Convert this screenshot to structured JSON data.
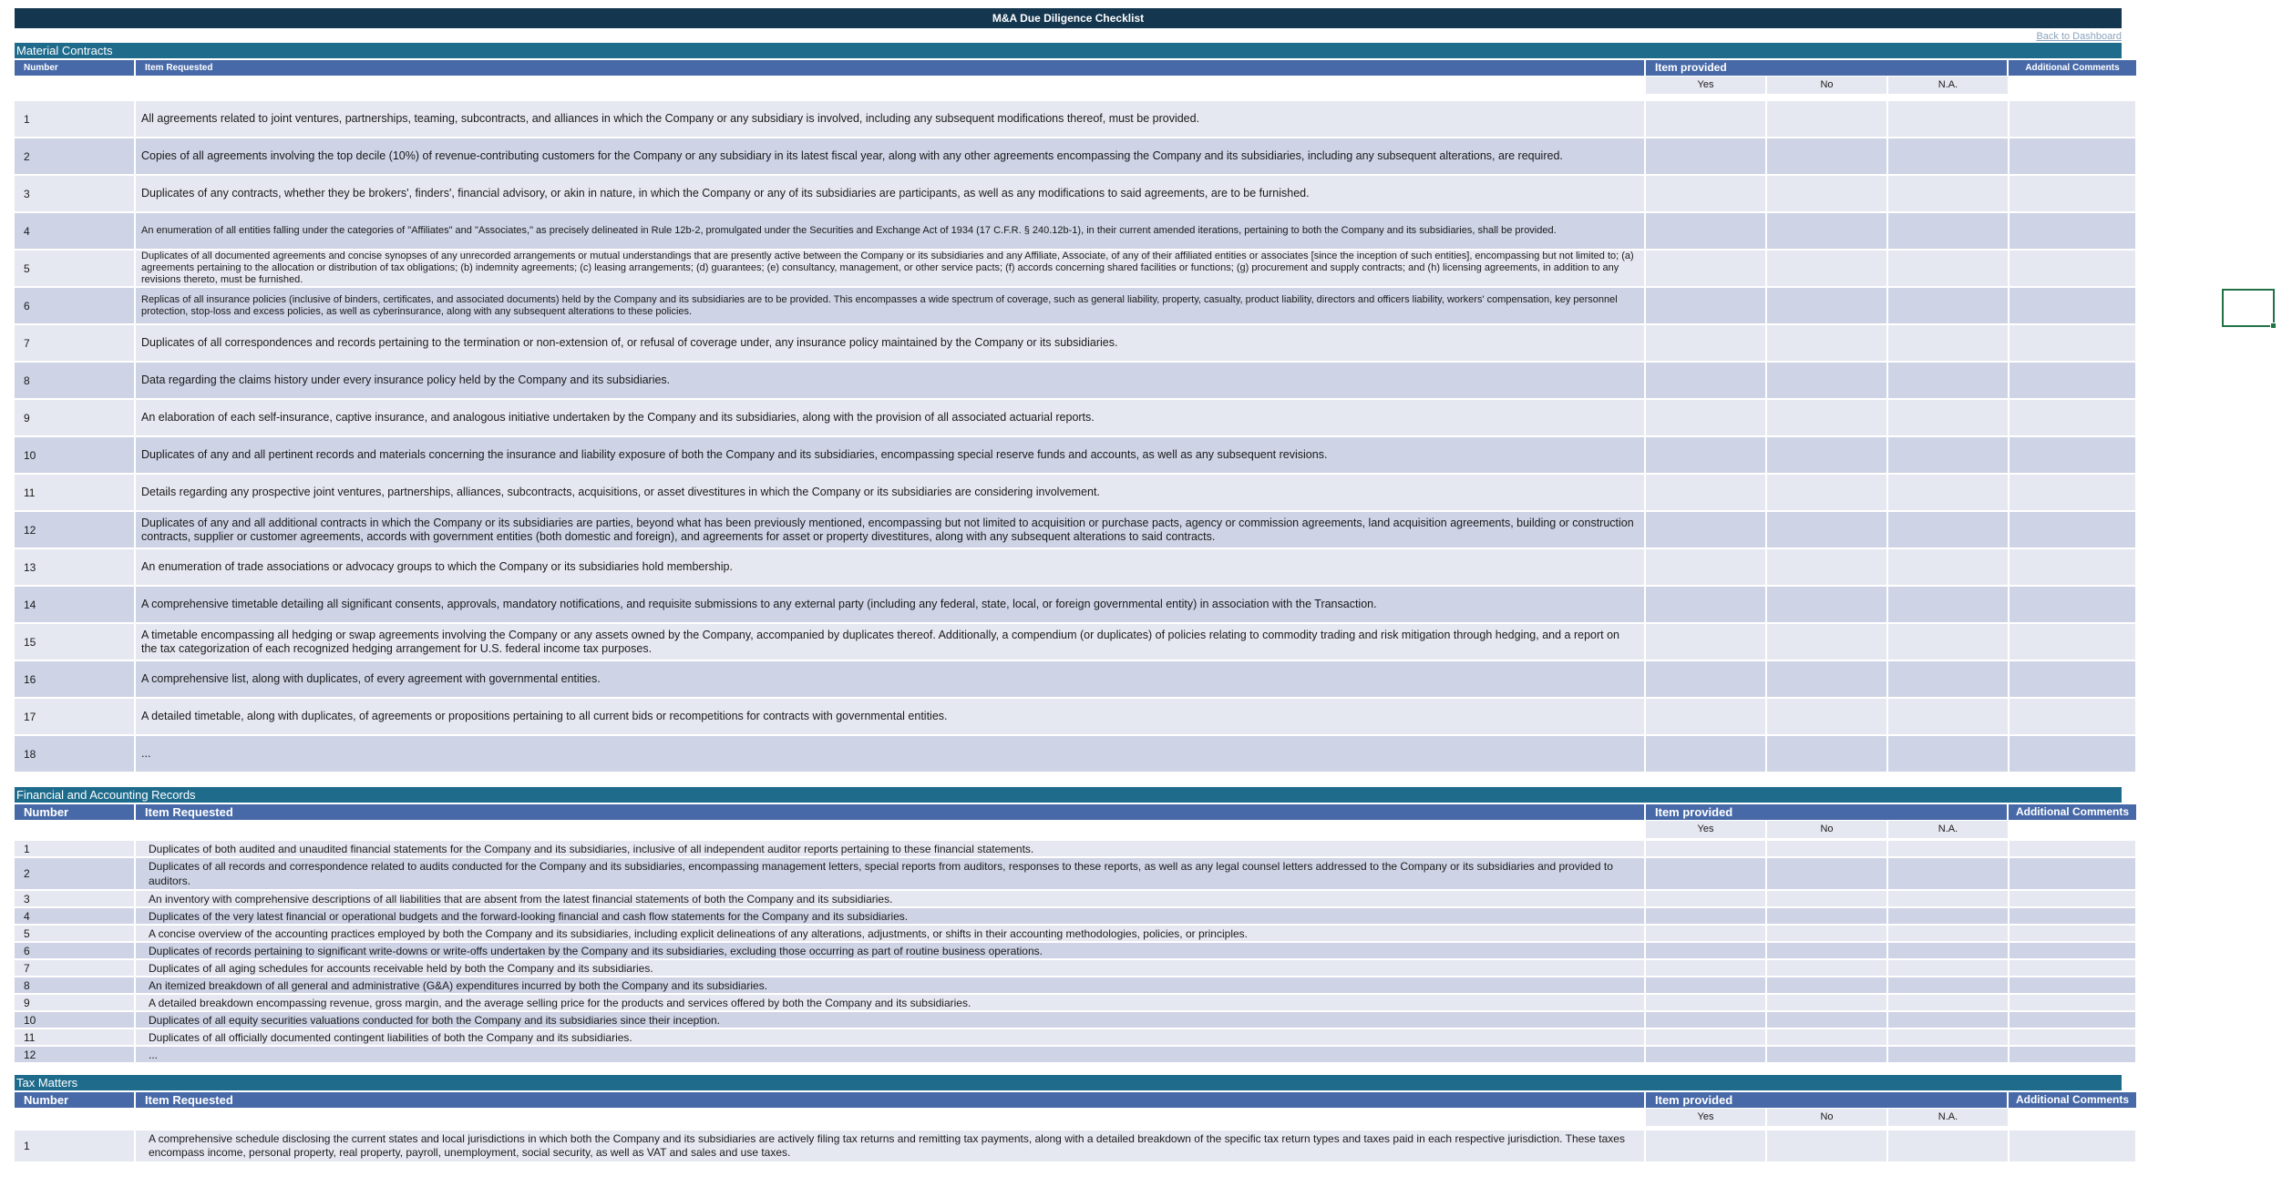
{
  "title": "M&A Due Diligence Checklist",
  "back_link": "Back to Dashboard",
  "headers": {
    "number": "Number",
    "item": "Item Requested",
    "item_alt": "Item Requested",
    "provided": "Item provided",
    "additional": "Additional Comments",
    "yes": "Yes",
    "no": "No",
    "na": "N.A."
  },
  "sections": [
    {
      "title": "Material Contracts",
      "rows": [
        {
          "n": "1",
          "t": "All agreements related to joint ventures, partnerships, teaming, subcontracts, and alliances in which the Company or any subsidiary is involved, including any subsequent modifications thereof, must be provided."
        },
        {
          "n": "2",
          "t": "Copies of all agreements involving the top decile (10%) of revenue-contributing customers for the Company or any subsidiary in its latest fiscal year, along with any other agreements encompassing the Company and its subsidiaries, including any subsequent alterations, are required."
        },
        {
          "n": "3",
          "t": "Duplicates of any contracts, whether they be brokers', finders', financial advisory, or akin in nature, in which the Company or any of its subsidiaries are participants, as well as any modifications to said agreements, are to be furnished."
        },
        {
          "n": "4",
          "t": "An enumeration of all entities falling under the categories of \"Affiliates\" and \"Associates,\" as precisely delineated in Rule 12b-2, promulgated under the Securities and Exchange Act of 1934 (17 C.F.R. § 240.12b-1), in their current amended iterations, pertaining to both the Company and its subsidiaries, shall be provided."
        },
        {
          "n": "5",
          "t": "Duplicates of all documented agreements and concise synopses of any unrecorded arrangements or mutual understandings that are presently active between the Company or its subsidiaries and any Affiliate, Associate, of any of their affiliated entities or associates [since the inception of such entities], encompassing but not limited to; (a) agreements pertaining to the allocation or distribution of tax obligations; (b) indemnity agreements; (c) leasing arrangements; (d) guarantees; (e) consultancy, management, or other service pacts; (f) accords concerning shared facilities or functions; (g) procurement and supply contracts; and (h) licensing agreements, in addition to any revisions thereto, must be furnished."
        },
        {
          "n": "6",
          "t": "Replicas of all insurance policies (inclusive of binders, certificates, and associated documents) held by the Company and its subsidiaries are to be provided. This encompasses a wide spectrum of coverage, such as general liability, property, casualty, product liability, directors and officers liability, workers' compensation, key personnel protection, stop-loss and excess policies, as well as cyberinsurance, along with any subsequent alterations to these policies."
        },
        {
          "n": "7",
          "t": "Duplicates of all correspondences and records pertaining to the termination or non-extension of, or refusal of coverage under, any insurance policy maintained by the Company or its subsidiaries."
        },
        {
          "n": "8",
          "t": "Data regarding the claims history under every insurance policy held by the Company and its subsidiaries."
        },
        {
          "n": "9",
          "t": "An elaboration of each self-insurance, captive insurance, and analogous initiative undertaken by the Company and its subsidiaries, along with the provision of all associated actuarial reports."
        },
        {
          "n": "10",
          "t": "Duplicates of any and all pertinent records and materials concerning the insurance and liability exposure of both the Company and its subsidiaries, encompassing special reserve funds and accounts, as well as any subsequent revisions."
        },
        {
          "n": "11",
          "t": "Details regarding any prospective joint ventures, partnerships, alliances, subcontracts, acquisitions, or asset divestitures in which the Company or its subsidiaries are considering involvement."
        },
        {
          "n": "12",
          "t": "Duplicates of any and all additional contracts in which the Company or its subsidiaries are parties, beyond what has been previously mentioned, encompassing but not limited to acquisition or purchase pacts, agency or commission agreements, land acquisition agreements, building or construction contracts, supplier or customer agreements, accords with government entities (both domestic and foreign), and agreements for asset or property divestitures, along with any subsequent alterations to said contracts."
        },
        {
          "n": "13",
          "t": "An enumeration of trade associations or advocacy groups to which the Company or its subsidiaries hold membership."
        },
        {
          "n": "14",
          "t": "A comprehensive timetable detailing all significant consents, approvals, mandatory notifications, and requisite submissions to any external party (including any federal, state, local, or foreign governmental entity) in association with the Transaction."
        },
        {
          "n": "15",
          "t": "A timetable encompassing all hedging or swap agreements involving the Company or any assets owned by the Company, accompanied by duplicates thereof. Additionally, a compendium (or duplicates) of policies relating to commodity trading and risk mitigation through hedging, and a report on the tax categorization of each recognized hedging arrangement for U.S. federal income tax purposes."
        },
        {
          "n": "16",
          "t": "A comprehensive list, along with duplicates, of every agreement with governmental entities."
        },
        {
          "n": "17",
          "t": "A detailed timetable, along with duplicates, of agreements or propositions pertaining to all current bids or recompetitions for contracts with governmental entities."
        },
        {
          "n": "18",
          "t": "..."
        }
      ]
    },
    {
      "title": "Financial and Accounting Records",
      "rows": [
        {
          "n": "1",
          "t": "Duplicates of both audited and unaudited financial statements for the Company and its subsidiaries, inclusive of all independent auditor reports pertaining to these financial statements."
        },
        {
          "n": "2",
          "t": "Duplicates of all records and correspondence related to audits conducted for the Company and its subsidiaries, encompassing management letters, special reports from auditors, responses to these reports, as well as any legal counsel letters addressed to the Company or its subsidiaries and provided to auditors."
        },
        {
          "n": "3",
          "t": "An inventory with comprehensive descriptions of all liabilities that are absent from the latest financial statements of both the Company and its subsidiaries."
        },
        {
          "n": "4",
          "t": "Duplicates of the very latest financial or operational budgets and the forward-looking financial and cash flow statements for the Company and its subsidiaries."
        },
        {
          "n": "5",
          "t": "A concise overview of the accounting practices employed by both the Company and its subsidiaries, including explicit delineations of any alterations, adjustments, or shifts in their accounting methodologies, policies, or principles."
        },
        {
          "n": "6",
          "t": "Duplicates of records pertaining to significant write-downs or write-offs undertaken by the Company and its subsidiaries, excluding those occurring as part of routine business operations."
        },
        {
          "n": "7",
          "t": "Duplicates of all aging schedules for accounts receivable held by both the Company and its subsidiaries."
        },
        {
          "n": "8",
          "t": "An itemized breakdown of all general and administrative (G&A) expenditures incurred by both the Company and its subsidiaries."
        },
        {
          "n": "9",
          "t": "A detailed breakdown encompassing revenue, gross margin, and the average selling price for the products and services offered by both the Company and its subsidiaries."
        },
        {
          "n": "10",
          "t": "Duplicates of all equity securities valuations conducted for both the Company and its subsidiaries since their inception."
        },
        {
          "n": "11",
          "t": "Duplicates of all officially documented contingent liabilities of both the Company and its subsidiaries."
        },
        {
          "n": "12",
          "t": "..."
        }
      ]
    },
    {
      "title": "Tax Matters",
      "rows": [
        {
          "n": "1",
          "t": "A comprehensive schedule disclosing the current states and local jurisdictions in which both the Company and its subsidiaries are actively filing tax returns and remitting tax payments, along with a detailed breakdown of the specific tax return types and taxes paid in each respective jurisdiction. These taxes encompass income, personal property, real property, payroll, unemployment, social security, as well as VAT and sales and use taxes."
        }
      ]
    }
  ]
}
